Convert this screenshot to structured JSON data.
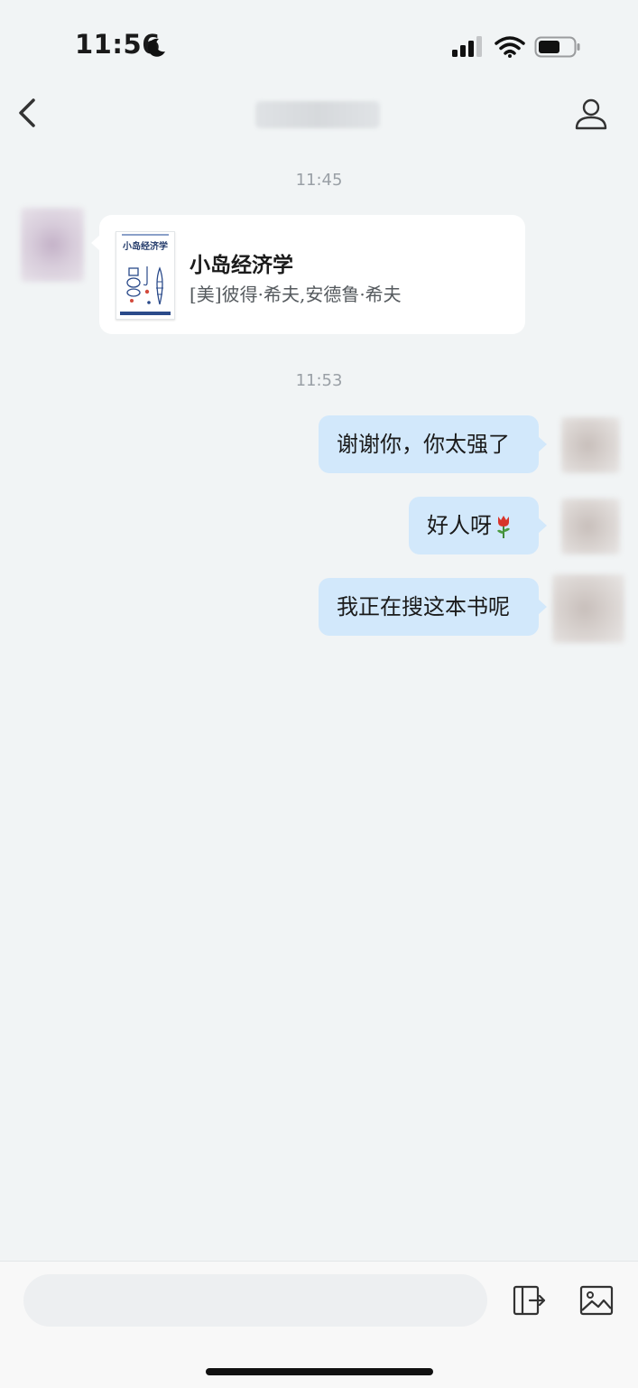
{
  "status_bar": {
    "time": "11:56"
  },
  "chat": {
    "timestamps": [
      "11:45",
      "11:53"
    ],
    "book_card": {
      "cover_title": "小岛经济学",
      "title": "小岛经济学",
      "author": "[美]彼得·希夫,安德鲁·希夫"
    },
    "messages": [
      {
        "text": "谢谢你，你太强了",
        "sender": "me"
      },
      {
        "text": "好人呀",
        "sender": "me",
        "emoji": "tulip-icon"
      },
      {
        "text": "我正在搜这本书呢",
        "sender": "me"
      }
    ]
  },
  "input": {
    "placeholder": ""
  },
  "colors": {
    "background": "#f1f4f5",
    "outgoing_bubble": "#d2e8fb",
    "card": "#ffffff",
    "timestamp": "#9aa0a6"
  }
}
